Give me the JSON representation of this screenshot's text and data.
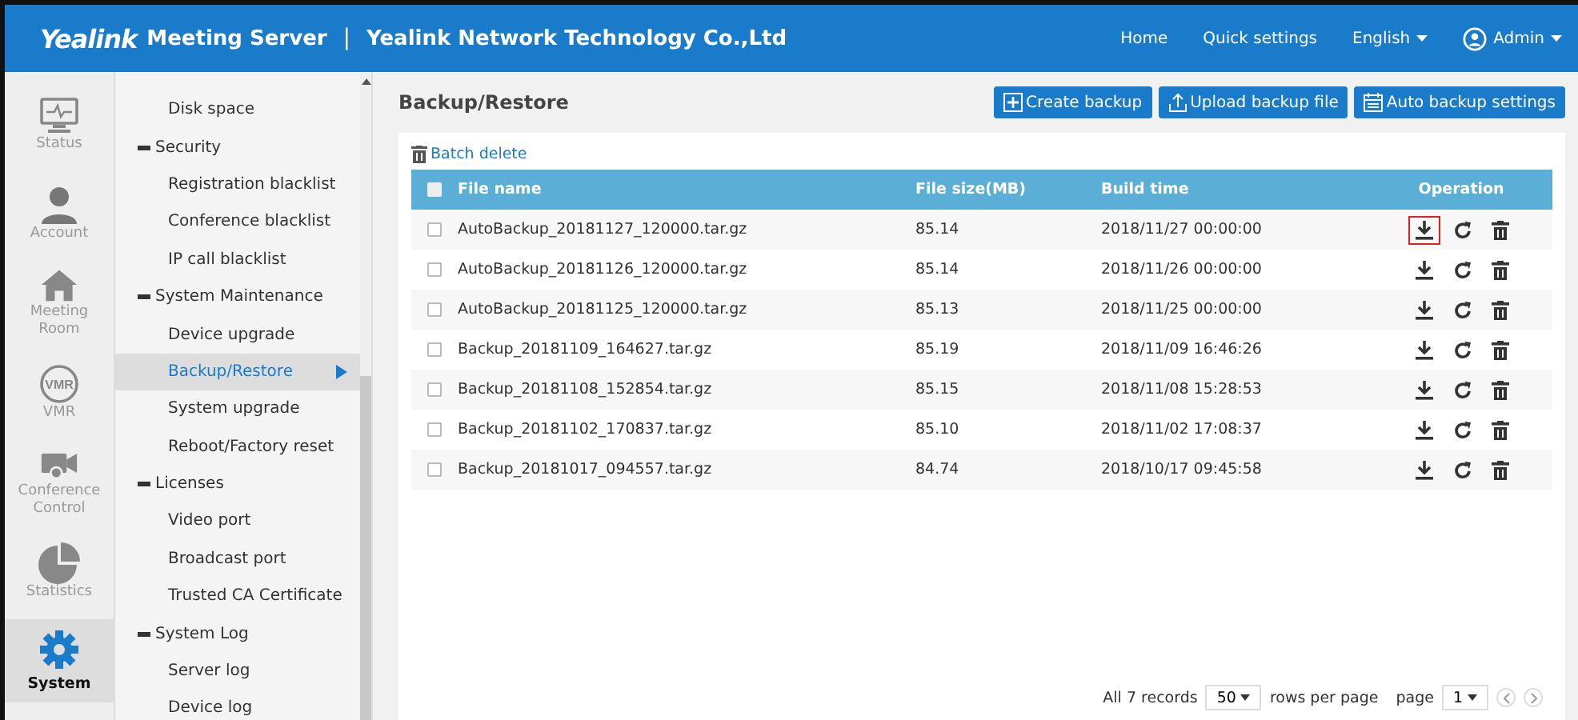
{
  "header": {
    "brand": "Yealink",
    "product": "Meeting Server",
    "separator": "|",
    "company": "Yealink Network Technology Co.,Ltd",
    "links": [
      "Home",
      "Quick settings"
    ],
    "language": "English",
    "user": "Admin"
  },
  "nav": [
    {
      "label": "Status",
      "selected": false
    },
    {
      "label": "Account",
      "selected": false
    },
    {
      "label": "Meeting Room",
      "selected": false
    },
    {
      "label": "VMR",
      "icon_text": "VMR",
      "selected": false
    },
    {
      "label": "Conference Control",
      "selected": false
    },
    {
      "label": "Statistics",
      "selected": false
    },
    {
      "label": "System",
      "selected": true
    }
  ],
  "menu": [
    {
      "kind": "item",
      "label": "Disk space",
      "selected": false
    },
    {
      "kind": "group",
      "label": "Security",
      "expanded": true
    },
    {
      "kind": "item",
      "label": "Registration blacklist",
      "selected": false
    },
    {
      "kind": "item",
      "label": "Conference blacklist",
      "selected": false
    },
    {
      "kind": "item",
      "label": "IP call blacklist",
      "selected": false
    },
    {
      "kind": "group",
      "label": "System Maintenance",
      "expanded": true
    },
    {
      "kind": "item",
      "label": "Device upgrade",
      "selected": false
    },
    {
      "kind": "item",
      "label": "Backup/Restore",
      "selected": true
    },
    {
      "kind": "item",
      "label": "System upgrade",
      "selected": false
    },
    {
      "kind": "item",
      "label": "Reboot/Factory reset",
      "selected": false
    },
    {
      "kind": "group",
      "label": "Licenses",
      "expanded": true
    },
    {
      "kind": "item",
      "label": "Video port",
      "selected": false
    },
    {
      "kind": "item",
      "label": "Broadcast port",
      "selected": false
    },
    {
      "kind": "item",
      "label": "Trusted CA Certificate",
      "selected": false
    },
    {
      "kind": "group",
      "label": "System Log",
      "expanded": true
    },
    {
      "kind": "item",
      "label": "Server log",
      "selected": false
    },
    {
      "kind": "item",
      "label": "Device log",
      "selected": false
    }
  ],
  "page_title": "Backup/Restore",
  "actions": [
    "Create backup",
    "Upload backup file",
    "Auto backup settings"
  ],
  "batch_delete": "Batch delete",
  "table": {
    "columns": [
      "File name",
      "File size(MB)",
      "Build time",
      "Operation"
    ],
    "header_checked": false,
    "rows": [
      {
        "name": "AutoBackup_20181127_120000.tar.gz",
        "size": "85.14",
        "time": "2018/11/27 00:00:00",
        "checked": false,
        "download_highlighted": true
      },
      {
        "name": "AutoBackup_20181126_120000.tar.gz",
        "size": "85.14",
        "time": "2018/11/26 00:00:00",
        "checked": false,
        "download_highlighted": false
      },
      {
        "name": "AutoBackup_20181125_120000.tar.gz",
        "size": "85.13",
        "time": "2018/11/25 00:00:00",
        "checked": false,
        "download_highlighted": false
      },
      {
        "name": "Backup_20181109_164627.tar.gz",
        "size": "85.19",
        "time": "2018/11/09 16:46:26",
        "checked": false,
        "download_highlighted": false
      },
      {
        "name": "Backup_20181108_152854.tar.gz",
        "size": "85.15",
        "time": "2018/11/08 15:28:53",
        "checked": false,
        "download_highlighted": false
      },
      {
        "name": "Backup_20181102_170837.tar.gz",
        "size": "85.10",
        "time": "2018/11/02 17:08:37",
        "checked": false,
        "download_highlighted": false
      },
      {
        "name": "Backup_20181017_094557.tar.gz",
        "size": "84.74",
        "time": "2018/10/17 09:45:58",
        "checked": false,
        "download_highlighted": false
      }
    ]
  },
  "pagination": {
    "total": "All 7 records",
    "per_page": "50",
    "per_page_label": "rows per page",
    "page_label": "page",
    "page": "1"
  }
}
